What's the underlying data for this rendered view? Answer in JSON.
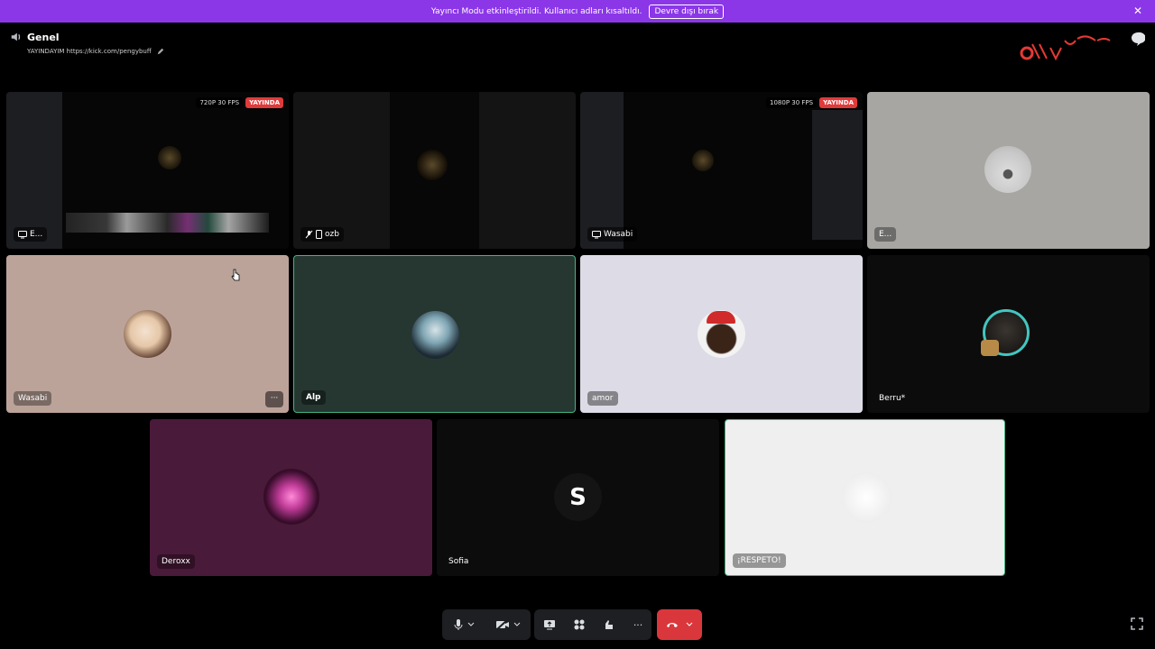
{
  "banner": {
    "message": "Yayıncı Modu etkinleştirildi. Kullanıcı adları kısaltıldı.",
    "button": "Devre dışı bırak",
    "close": "✕"
  },
  "channel": {
    "name": "Genel",
    "status": "YAYINDAYIM https://kick.com/pengybuff"
  },
  "tiles": {
    "t1": {
      "name": "E...",
      "quality": "720P 30 FPS",
      "live": "YAYINDA"
    },
    "t2": {
      "name": "ozb"
    },
    "t3": {
      "name": "Wasabi",
      "quality": "1080P 30 FPS",
      "live": "YAYINDA"
    },
    "t4": {
      "name": "E..."
    },
    "t5": {
      "name": "Wasabi",
      "more": "···"
    },
    "t6": {
      "name": "Alp"
    },
    "t7": {
      "name": "amor"
    },
    "t8": {
      "name": "Berru*"
    },
    "t9": {
      "name": "Deroxx"
    },
    "t10": {
      "name": "Sofia",
      "initial": "S"
    },
    "t11": {
      "name": "¡RESPETO!"
    }
  },
  "controls": {
    "more": "···"
  },
  "colors": {
    "banner": "#8b37e8",
    "hangup": "#da373c",
    "speaking": "#43b581"
  },
  "icons": [
    "speaker-icon",
    "pencil-icon",
    "chat-icon",
    "microphone-icon",
    "camera-off-icon",
    "share-screen-icon",
    "activities-icon",
    "soundboard-icon",
    "hangup-icon",
    "fit-screen-icon",
    "mic-muted-icon",
    "screen-share-badge-icon"
  ]
}
